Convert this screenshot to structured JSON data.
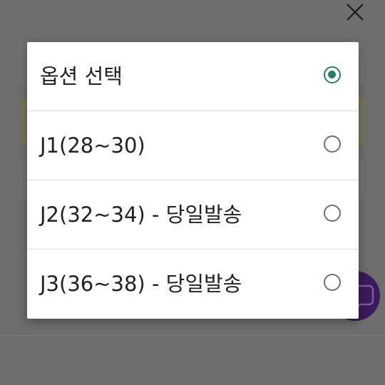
{
  "dialog": {
    "options": [
      {
        "label": "옵션 선택",
        "selected": true
      },
      {
        "label": "J1(28~30)",
        "selected": false
      },
      {
        "label": "J2(32~34) - 당일발송",
        "selected": false
      },
      {
        "label": "J3(36~38) - 당일발송",
        "selected": false
      }
    ]
  },
  "icons": {
    "close": "close-icon",
    "fab": "chat-icon"
  },
  "colors": {
    "accent": "#2e7d64",
    "scrim": "#6e6e6e",
    "fab": "#3a1a5a"
  }
}
